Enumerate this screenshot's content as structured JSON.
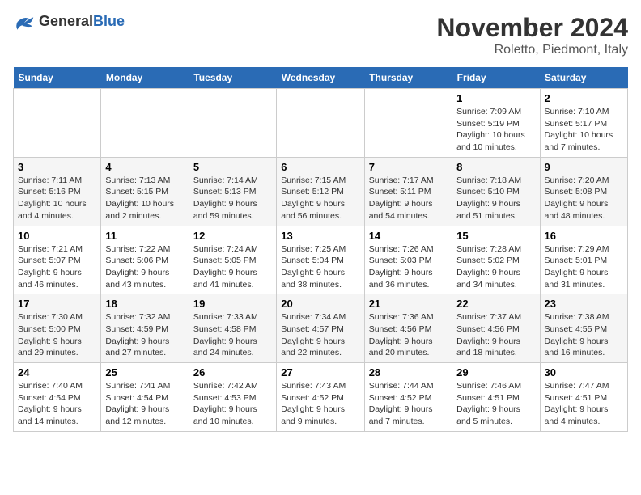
{
  "header": {
    "logo_general": "General",
    "logo_blue": "Blue",
    "month_title": "November 2024",
    "subtitle": "Roletto, Piedmont, Italy"
  },
  "days_of_week": [
    "Sunday",
    "Monday",
    "Tuesday",
    "Wednesday",
    "Thursday",
    "Friday",
    "Saturday"
  ],
  "weeks": [
    [
      {
        "day": "",
        "info": ""
      },
      {
        "day": "",
        "info": ""
      },
      {
        "day": "",
        "info": ""
      },
      {
        "day": "",
        "info": ""
      },
      {
        "day": "",
        "info": ""
      },
      {
        "day": "1",
        "info": "Sunrise: 7:09 AM\nSunset: 5:19 PM\nDaylight: 10 hours and 10 minutes."
      },
      {
        "day": "2",
        "info": "Sunrise: 7:10 AM\nSunset: 5:17 PM\nDaylight: 10 hours and 7 minutes."
      }
    ],
    [
      {
        "day": "3",
        "info": "Sunrise: 7:11 AM\nSunset: 5:16 PM\nDaylight: 10 hours and 4 minutes."
      },
      {
        "day": "4",
        "info": "Sunrise: 7:13 AM\nSunset: 5:15 PM\nDaylight: 10 hours and 2 minutes."
      },
      {
        "day": "5",
        "info": "Sunrise: 7:14 AM\nSunset: 5:13 PM\nDaylight: 9 hours and 59 minutes."
      },
      {
        "day": "6",
        "info": "Sunrise: 7:15 AM\nSunset: 5:12 PM\nDaylight: 9 hours and 56 minutes."
      },
      {
        "day": "7",
        "info": "Sunrise: 7:17 AM\nSunset: 5:11 PM\nDaylight: 9 hours and 54 minutes."
      },
      {
        "day": "8",
        "info": "Sunrise: 7:18 AM\nSunset: 5:10 PM\nDaylight: 9 hours and 51 minutes."
      },
      {
        "day": "9",
        "info": "Sunrise: 7:20 AM\nSunset: 5:08 PM\nDaylight: 9 hours and 48 minutes."
      }
    ],
    [
      {
        "day": "10",
        "info": "Sunrise: 7:21 AM\nSunset: 5:07 PM\nDaylight: 9 hours and 46 minutes."
      },
      {
        "day": "11",
        "info": "Sunrise: 7:22 AM\nSunset: 5:06 PM\nDaylight: 9 hours and 43 minutes."
      },
      {
        "day": "12",
        "info": "Sunrise: 7:24 AM\nSunset: 5:05 PM\nDaylight: 9 hours and 41 minutes."
      },
      {
        "day": "13",
        "info": "Sunrise: 7:25 AM\nSunset: 5:04 PM\nDaylight: 9 hours and 38 minutes."
      },
      {
        "day": "14",
        "info": "Sunrise: 7:26 AM\nSunset: 5:03 PM\nDaylight: 9 hours and 36 minutes."
      },
      {
        "day": "15",
        "info": "Sunrise: 7:28 AM\nSunset: 5:02 PM\nDaylight: 9 hours and 34 minutes."
      },
      {
        "day": "16",
        "info": "Sunrise: 7:29 AM\nSunset: 5:01 PM\nDaylight: 9 hours and 31 minutes."
      }
    ],
    [
      {
        "day": "17",
        "info": "Sunrise: 7:30 AM\nSunset: 5:00 PM\nDaylight: 9 hours and 29 minutes."
      },
      {
        "day": "18",
        "info": "Sunrise: 7:32 AM\nSunset: 4:59 PM\nDaylight: 9 hours and 27 minutes."
      },
      {
        "day": "19",
        "info": "Sunrise: 7:33 AM\nSunset: 4:58 PM\nDaylight: 9 hours and 24 minutes."
      },
      {
        "day": "20",
        "info": "Sunrise: 7:34 AM\nSunset: 4:57 PM\nDaylight: 9 hours and 22 minutes."
      },
      {
        "day": "21",
        "info": "Sunrise: 7:36 AM\nSunset: 4:56 PM\nDaylight: 9 hours and 20 minutes."
      },
      {
        "day": "22",
        "info": "Sunrise: 7:37 AM\nSunset: 4:56 PM\nDaylight: 9 hours and 18 minutes."
      },
      {
        "day": "23",
        "info": "Sunrise: 7:38 AM\nSunset: 4:55 PM\nDaylight: 9 hours and 16 minutes."
      }
    ],
    [
      {
        "day": "24",
        "info": "Sunrise: 7:40 AM\nSunset: 4:54 PM\nDaylight: 9 hours and 14 minutes."
      },
      {
        "day": "25",
        "info": "Sunrise: 7:41 AM\nSunset: 4:54 PM\nDaylight: 9 hours and 12 minutes."
      },
      {
        "day": "26",
        "info": "Sunrise: 7:42 AM\nSunset: 4:53 PM\nDaylight: 9 hours and 10 minutes."
      },
      {
        "day": "27",
        "info": "Sunrise: 7:43 AM\nSunset: 4:52 PM\nDaylight: 9 hours and 9 minutes."
      },
      {
        "day": "28",
        "info": "Sunrise: 7:44 AM\nSunset: 4:52 PM\nDaylight: 9 hours and 7 minutes."
      },
      {
        "day": "29",
        "info": "Sunrise: 7:46 AM\nSunset: 4:51 PM\nDaylight: 9 hours and 5 minutes."
      },
      {
        "day": "30",
        "info": "Sunrise: 7:47 AM\nSunset: 4:51 PM\nDaylight: 9 hours and 4 minutes."
      }
    ]
  ]
}
